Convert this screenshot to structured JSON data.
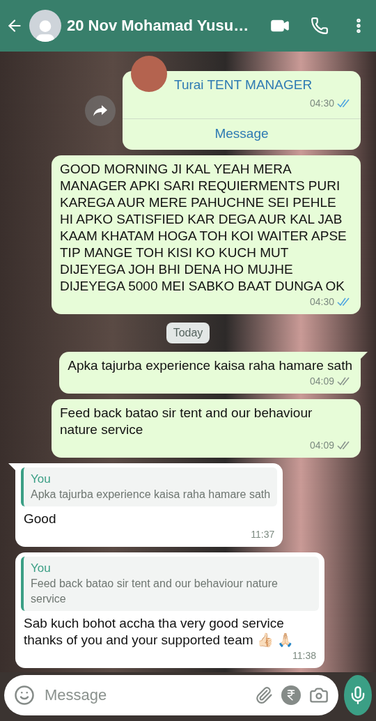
{
  "header": {
    "title": "20 Nov Mohamad Yusu…"
  },
  "messages": [
    {
      "kind": "contact",
      "outgoing": true,
      "name": "Turai TENT MANAGER",
      "time": "04:30",
      "read": true,
      "action": "Message"
    },
    {
      "kind": "text",
      "outgoing": true,
      "text": "GOOD MORNING JI KAL YEAH MERA MANAGER APKI SARI REQUIERMENTS PURI KAREGA AUR MERE PAHUCHNE SEI PEHLE HI APKO SATISFIED KAR DEGA AUR KAL JAB KAAM KHATAM HOGA TOH KOI WAITER APSE TIP MANGE TOH KISI KO KUCH MUT DIJEYEGA JOH BHI DENA HO MUJHE DIJEYEGA 5000 MEI SABKO BAAT DUNGA OK",
      "time": "04:30",
      "read": true,
      "tail": false
    },
    {
      "kind": "date",
      "text": "Today"
    },
    {
      "kind": "text",
      "outgoing": true,
      "text": "Apka tajurba experience kaisa raha hamare sath",
      "time": "04:09",
      "read": false,
      "tail": true
    },
    {
      "kind": "text",
      "outgoing": true,
      "text": "Feed back batao sir tent and our behaviour nature service",
      "time": "04:09",
      "read": false,
      "tail": false
    },
    {
      "kind": "reply",
      "outgoing": false,
      "quote_author": "You",
      "quote_text": "Apka tajurba experience kaisa raha hamare sath",
      "text": "Good",
      "time": "11:37",
      "tail": true
    },
    {
      "kind": "reply",
      "outgoing": false,
      "quote_author": "You",
      "quote_text": "Feed back batao sir tent and our behaviour nature service",
      "text": "Sab kuch bohot accha tha very good service thanks of you and your supported team 👍🏻 🙏🏻",
      "time": "11:38",
      "tail": false
    }
  ],
  "composer": {
    "placeholder": "Message"
  }
}
